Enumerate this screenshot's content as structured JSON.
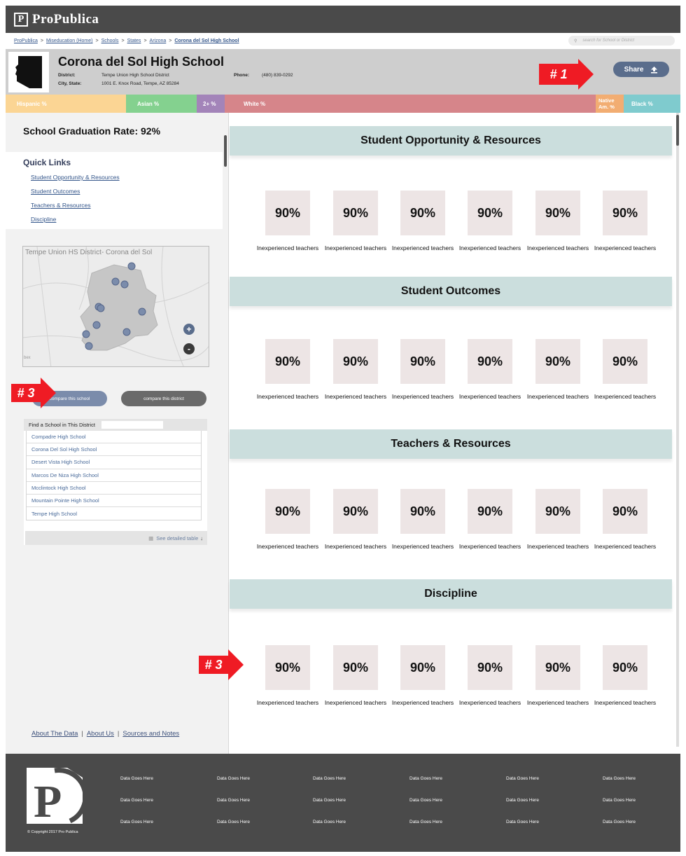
{
  "brand": {
    "logo_mark": "P",
    "name": "ProPublica"
  },
  "breadcrumb": {
    "items": [
      "ProPublica",
      "Miseducation (Home)",
      "Schools",
      "States",
      "Arizona"
    ],
    "current": "Corona del Sol High School",
    "separator": ">"
  },
  "search": {
    "placeholder": "search for School or District",
    "icon": "search-icon"
  },
  "school": {
    "name": "Corona del Sol High School",
    "district_label": "District:",
    "district": "Tempe Union High School District",
    "city_label": "City, State:",
    "address": "1001 E. Knox Road, Tempe, AZ  85284",
    "phone_label": "Phone:",
    "phone": "(480) 839-0292"
  },
  "share": {
    "label": "Share",
    "icon": "upload-arrow-icon"
  },
  "demographics": {
    "hispanic": "Hispanic  %",
    "asian": "Asian  %",
    "two_plus": "2+  %",
    "white": "White  %",
    "native": "Native Am.  %",
    "black": "Black %",
    "colors": {
      "hispanic": "#fbd594",
      "asian": "#84d18f",
      "two_plus": "#a384b9",
      "white": "#d6858a",
      "native": "#f2ad72",
      "black": "#7fcbce"
    }
  },
  "graduation": {
    "text": "School Graduation Rate: 92%"
  },
  "quick_links": {
    "title": "Quick Links",
    "items": [
      "Student Opportunity & Resources",
      "Student Outcomes",
      "Teachers & Resources",
      "Discipline"
    ]
  },
  "map": {
    "title": "Tempe Union HS District- Corona del Sol",
    "zoom_in": "+",
    "zoom_out": "-",
    "attribution": "bex"
  },
  "compare": {
    "school_label": "compare this school",
    "district_label": "compare this district"
  },
  "finder": {
    "title": "Find a School in This District",
    "schools": [
      "Compadre High School",
      "Corona Del Sol High School",
      "Desert Vista High School",
      "Marcos De Niza High School",
      "Mcclintock High School",
      "Mountain Pointe High School",
      "Tempe High School"
    ],
    "footer": "See detailed table"
  },
  "footer_links": [
    "About The Data",
    "About Us",
    "Sources and Notes"
  ],
  "sections": [
    {
      "title": "Student Opportunity & Resources",
      "stats": [
        {
          "value": "90%",
          "label": "Inexperienced teachers"
        },
        {
          "value": "90%",
          "label": "Inexperienced teachers"
        },
        {
          "value": "90%",
          "label": "Inexperienced teachers"
        },
        {
          "value": "90%",
          "label": "Inexperienced teachers"
        },
        {
          "value": "90%",
          "label": "Inexperienced teachers"
        },
        {
          "value": "90%",
          "label": "Inexperienced teachers"
        }
      ]
    },
    {
      "title": "Student Outcomes",
      "stats": [
        {
          "value": "90%",
          "label": "Inexperienced teachers"
        },
        {
          "value": "90%",
          "label": "Inexperienced teachers"
        },
        {
          "value": "90%",
          "label": "Inexperienced teachers"
        },
        {
          "value": "90%",
          "label": "Inexperienced teachers"
        },
        {
          "value": "90%",
          "label": "Inexperienced teachers"
        },
        {
          "value": "90%",
          "label": "Inexperienced teachers"
        }
      ]
    },
    {
      "title": "Teachers & Resources",
      "stats": [
        {
          "value": "90%",
          "label": "Inexperienced teachers"
        },
        {
          "value": "90%",
          "label": "Inexperienced teachers"
        },
        {
          "value": "90%",
          "label": "Inexperienced teachers"
        },
        {
          "value": "90%",
          "label": "Inexperienced teachers"
        },
        {
          "value": "90%",
          "label": "Inexperienced teachers"
        },
        {
          "value": "90%",
          "label": "Inexperienced teachers"
        }
      ]
    },
    {
      "title": "Discipline",
      "stats": [
        {
          "value": "90%",
          "label": "Inexperienced teachers"
        },
        {
          "value": "90%",
          "label": "Inexperienced teachers"
        },
        {
          "value": "90%",
          "label": "Inexperienced teachers"
        },
        {
          "value": "90%",
          "label": "Inexperienced teachers"
        },
        {
          "value": "90%",
          "label": "Inexperienced teachers"
        },
        {
          "value": "90%",
          "label": "Inexperienced teachers"
        }
      ]
    }
  ],
  "callouts": [
    "# 1",
    "# 3",
    "# 3"
  ],
  "footer": {
    "copyright": "© Copyright 2017 Pro Publica",
    "cells": [
      [
        "Data Goes Here",
        "Data Goes Here",
        "Data Goes Here",
        "Data Goes Here",
        "Data Goes Here",
        "Data Goes Here"
      ],
      [
        "Data Goes Here",
        "Data Goes Here",
        "Data Goes Here",
        "Data Goes Here",
        "Data Goes Here",
        "Data Goes Here"
      ],
      [
        "Data Goes Here",
        "Data Goes Here",
        "Data Goes Here",
        "Data Goes Here",
        "Data Goes Here",
        "Data Goes Here"
      ]
    ]
  },
  "accent_colors": {
    "topbar": "#4a4a4a",
    "section_head": "#cbdedd",
    "stat_box": "#ede5e5",
    "callout": "#ef1b24",
    "share": "#5a6d8c"
  }
}
